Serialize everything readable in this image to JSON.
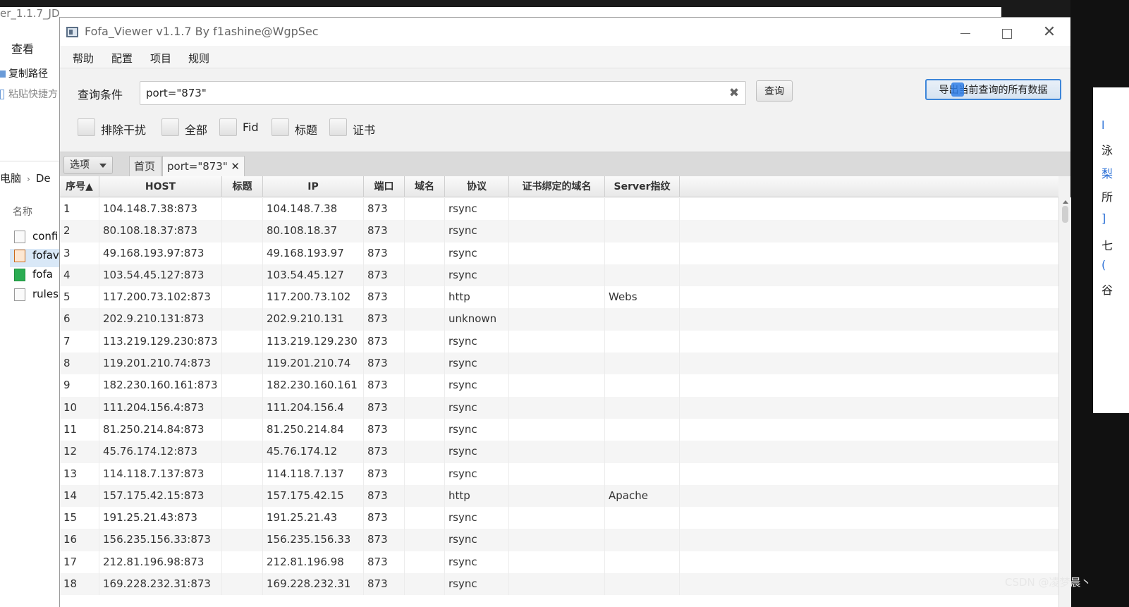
{
  "background_window": {
    "title": "er_1.1.7_JD",
    "view_menu": "查看",
    "copy_path": "复制路径",
    "paste_shortcut": "粘贴快捷方",
    "breadcrumb": [
      "电脑",
      "De"
    ],
    "column_name": "名称",
    "files": [
      "confi",
      "fofav",
      "fofa",
      "rules"
    ]
  },
  "right_fragment_chars": [
    "l",
    "泳",
    "梨",
    "所",
    "]",
    "七",
    "(",
    "谷"
  ],
  "window": {
    "title": "Fofa_Viewer v1.1.7 By f1ashine@WgpSec",
    "min": "—",
    "max": "☐",
    "close": "✕"
  },
  "menu": [
    "帮助",
    "配置",
    "项目",
    "规则"
  ],
  "query": {
    "label": "查询条件",
    "value": "port=\"873\"",
    "clear": "✖",
    "search_label": "查询",
    "export_label": "导出当前查询的所有数据"
  },
  "checkboxes": [
    "排除干扰",
    "全部",
    "Fid",
    "标题",
    "证书"
  ],
  "tabs": {
    "options": "选项",
    "home": "首页",
    "query_tab": "port=\"873\"",
    "close": "✕"
  },
  "table": {
    "headers": [
      "序号▲",
      "HOST",
      "标题",
      "IP",
      "端口",
      "域名",
      "协议",
      "证书绑定的域名",
      "Server指纹"
    ],
    "rows": [
      [
        "1",
        "104.148.7.38:873",
        "",
        "104.148.7.38",
        "873",
        "",
        "rsync",
        "",
        ""
      ],
      [
        "2",
        "80.108.18.37:873",
        "",
        "80.108.18.37",
        "873",
        "",
        "rsync",
        "",
        ""
      ],
      [
        "3",
        "49.168.193.97:873",
        "",
        "49.168.193.97",
        "873",
        "",
        "rsync",
        "",
        ""
      ],
      [
        "4",
        "103.54.45.127:873",
        "",
        "103.54.45.127",
        "873",
        "",
        "rsync",
        "",
        ""
      ],
      [
        "5",
        "117.200.73.102:873",
        "",
        "117.200.73.102",
        "873",
        "",
        "http",
        "",
        "Webs"
      ],
      [
        "6",
        "202.9.210.131:873",
        "",
        "202.9.210.131",
        "873",
        "",
        "unknown",
        "",
        ""
      ],
      [
        "7",
        "113.219.129.230:873",
        "",
        "113.219.129.230",
        "873",
        "",
        "rsync",
        "",
        ""
      ],
      [
        "8",
        "119.201.210.74:873",
        "",
        "119.201.210.74",
        "873",
        "",
        "rsync",
        "",
        ""
      ],
      [
        "9",
        "182.230.160.161:873",
        "",
        "182.230.160.161",
        "873",
        "",
        "rsync",
        "",
        ""
      ],
      [
        "10",
        "111.204.156.4:873",
        "",
        "111.204.156.4",
        "873",
        "",
        "rsync",
        "",
        ""
      ],
      [
        "11",
        "81.250.214.84:873",
        "",
        "81.250.214.84",
        "873",
        "",
        "rsync",
        "",
        ""
      ],
      [
        "12",
        "45.76.174.12:873",
        "",
        "45.76.174.12",
        "873",
        "",
        "rsync",
        "",
        ""
      ],
      [
        "13",
        "114.118.7.137:873",
        "",
        "114.118.7.137",
        "873",
        "",
        "rsync",
        "",
        ""
      ],
      [
        "14",
        "157.175.42.15:873",
        "",
        "157.175.42.15",
        "873",
        "",
        "http",
        "",
        "Apache"
      ],
      [
        "15",
        "191.25.21.43:873",
        "",
        "191.25.21.43",
        "873",
        "",
        "rsync",
        "",
        ""
      ],
      [
        "16",
        "156.235.156.33:873",
        "",
        "156.235.156.33",
        "873",
        "",
        "rsync",
        "",
        ""
      ],
      [
        "17",
        "212.81.196.98:873",
        "",
        "212.81.196.98",
        "873",
        "",
        "rsync",
        "",
        ""
      ],
      [
        "18",
        "169.228.232.31:873",
        "",
        "169.228.232.31",
        "873",
        "",
        "rsync",
        "",
        ""
      ]
    ]
  },
  "watermark": "CSDN @凌梦晨丶"
}
